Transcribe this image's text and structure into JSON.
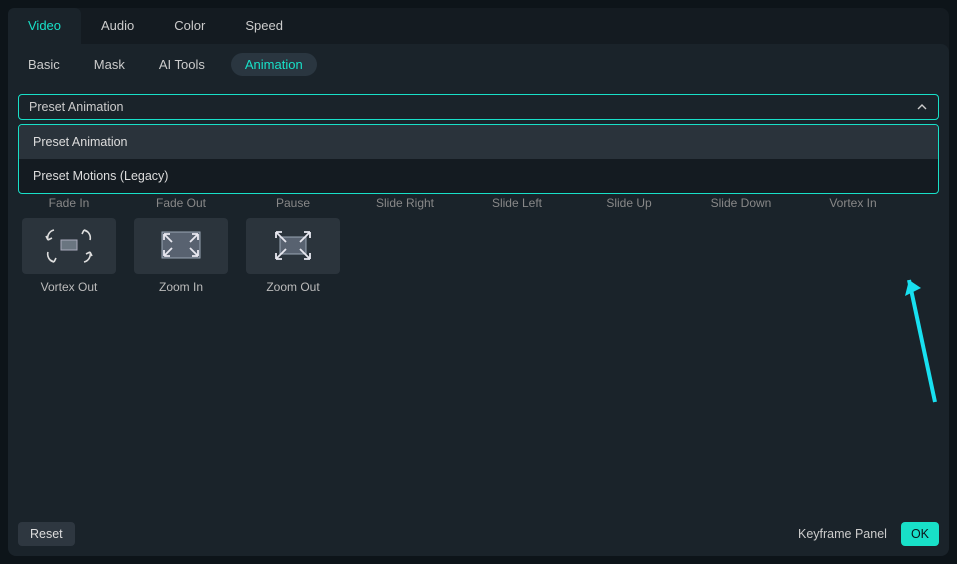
{
  "topTabs": {
    "video": "Video",
    "audio": "Audio",
    "color": "Color",
    "speed": "Speed"
  },
  "subTabs": {
    "basic": "Basic",
    "mask": "Mask",
    "aiTools": "AI Tools",
    "animation": "Animation"
  },
  "dropdown": {
    "selected": "Preset Animation",
    "options": {
      "preset": "Preset Animation",
      "legacy": "Preset Motions (Legacy)"
    }
  },
  "row1": {
    "fadeIn": "Fade In",
    "fadeOut": "Fade Out",
    "pause": "Pause",
    "slideRight": "Slide Right",
    "slideLeft": "Slide Left",
    "slideUp": "Slide Up",
    "slideDown": "Slide Down",
    "vortexIn": "Vortex In"
  },
  "row2": {
    "vortexOut": "Vortex Out",
    "zoomIn": "Zoom In",
    "zoomOut": "Zoom Out"
  },
  "footer": {
    "reset": "Reset",
    "keyframe": "Keyframe Panel",
    "ok": "OK"
  }
}
